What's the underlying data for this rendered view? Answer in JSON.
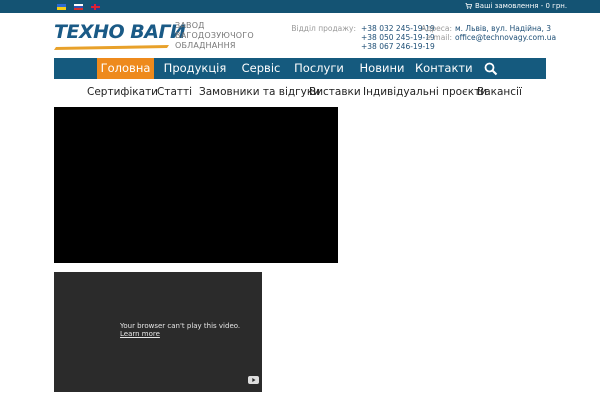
{
  "topbar": {
    "cart_text": "Ваші замовлення - 0 грн.",
    "languages": [
      "uk",
      "ru",
      "en"
    ]
  },
  "logo": {
    "text": "ТЕХНО ВАГИ",
    "tagline": [
      "ЗАВОД",
      "ВАГОДОЗУЮЧОГО",
      "ОБЛАДНАННЯ"
    ]
  },
  "contacts": {
    "sales_label": "Відділ продажу:",
    "phones": [
      "+38 032 245-19-19",
      "+38 050 245-19-19",
      "+38 067 246-19-19"
    ],
    "address_label": "Адреса:",
    "address": "м. Львів, вул. Надійна, 3",
    "email_label": "e-mail:",
    "email": "office@technovagy.com.ua"
  },
  "nav": {
    "items": [
      "Головна",
      "Продукція",
      "Сервіс",
      "Послуги",
      "Новини",
      "Контакти"
    ],
    "active_index": 0
  },
  "subnav": {
    "items": [
      "Сертифікати",
      "Статті",
      "Замовники та відгуки",
      "Виставки",
      "Індивідуальні проєкти",
      "Вакансії"
    ]
  },
  "video2": {
    "message": "Your browser can't play this video.",
    "link": "Learn more"
  },
  "colors": {
    "topbar": "#145373",
    "nav": "#155a7e",
    "nav_active": "#ee8a1c",
    "video_dark": "#2b2b2b"
  },
  "icons": [
    "cart-icon",
    "search-icon",
    "youtube-icon",
    "flag-ua-icon",
    "flag-ru-icon",
    "flag-uk-icon"
  ]
}
